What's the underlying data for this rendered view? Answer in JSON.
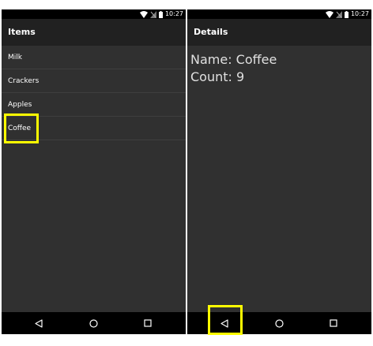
{
  "status_bar": {
    "time": "10:27",
    "icons": [
      "wifi-icon",
      "no-signal-icon",
      "battery-icon"
    ]
  },
  "list_screen": {
    "title": "Items",
    "items": [
      {
        "label": "Milk"
      },
      {
        "label": "Crackers"
      },
      {
        "label": "Apples"
      },
      {
        "label": "Coffee"
      }
    ]
  },
  "detail_screen": {
    "title": "Details",
    "name_line": "Name: Coffee",
    "count_line": "Count: 9"
  },
  "nav_bar": {
    "buttons": [
      "back-icon",
      "home-icon",
      "recents-icon"
    ]
  },
  "colors": {
    "background": "#303030",
    "app_bar": "#212121",
    "status_bar": "#000000",
    "highlight": "#ffff00",
    "text": "#ffffff"
  }
}
